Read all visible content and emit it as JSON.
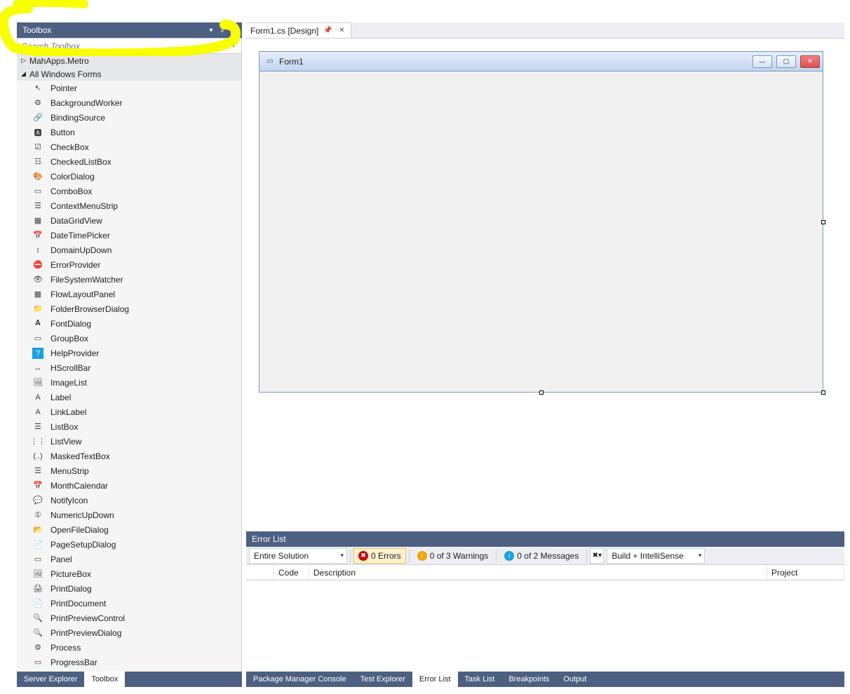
{
  "toolbox": {
    "title": "Toolbox",
    "search_placeholder": "Search Toolbox",
    "categories": [
      {
        "name": "MahApps.Metro",
        "expanded": false
      },
      {
        "name": "All Windows Forms",
        "expanded": true
      }
    ],
    "items": [
      "Pointer",
      "BackgroundWorker",
      "BindingSource",
      "Button",
      "CheckBox",
      "CheckedListBox",
      "ColorDialog",
      "ComboBox",
      "ContextMenuStrip",
      "DataGridView",
      "DateTimePicker",
      "DomainUpDown",
      "ErrorProvider",
      "FileSystemWatcher",
      "FlowLayoutPanel",
      "FolderBrowserDialog",
      "FontDialog",
      "GroupBox",
      "HelpProvider",
      "HScrollBar",
      "ImageList",
      "Label",
      "LinkLabel",
      "ListBox",
      "ListView",
      "MaskedTextBox",
      "MenuStrip",
      "MonthCalendar",
      "NotifyIcon",
      "NumericUpDown",
      "OpenFileDialog",
      "PageSetupDialog",
      "Panel",
      "PictureBox",
      "PrintDialog",
      "PrintDocument",
      "PrintPreviewControl",
      "PrintPreviewDialog",
      "Process",
      "ProgressBar"
    ]
  },
  "sidebar_tabs": [
    "Server Explorer",
    "Toolbox"
  ],
  "sidebar_active_tab": "Toolbox",
  "document": {
    "tab_label": "Form1.cs [Design]",
    "form_title": "Form1"
  },
  "error_list": {
    "title": "Error List",
    "scope": "Entire Solution",
    "errors_label": "0 Errors",
    "warnings_label": "0 of 3 Warnings",
    "messages_label": "0 of 2 Messages",
    "build_filter": "Build + IntelliSense",
    "columns": [
      "",
      "Code",
      "Description",
      "Project"
    ]
  },
  "bottom_tabs_right": [
    "Package Manager Console",
    "Test Explorer",
    "Error List",
    "Task List",
    "Breakpoints",
    "Output"
  ],
  "bottom_tabs_right_active": "Error List"
}
